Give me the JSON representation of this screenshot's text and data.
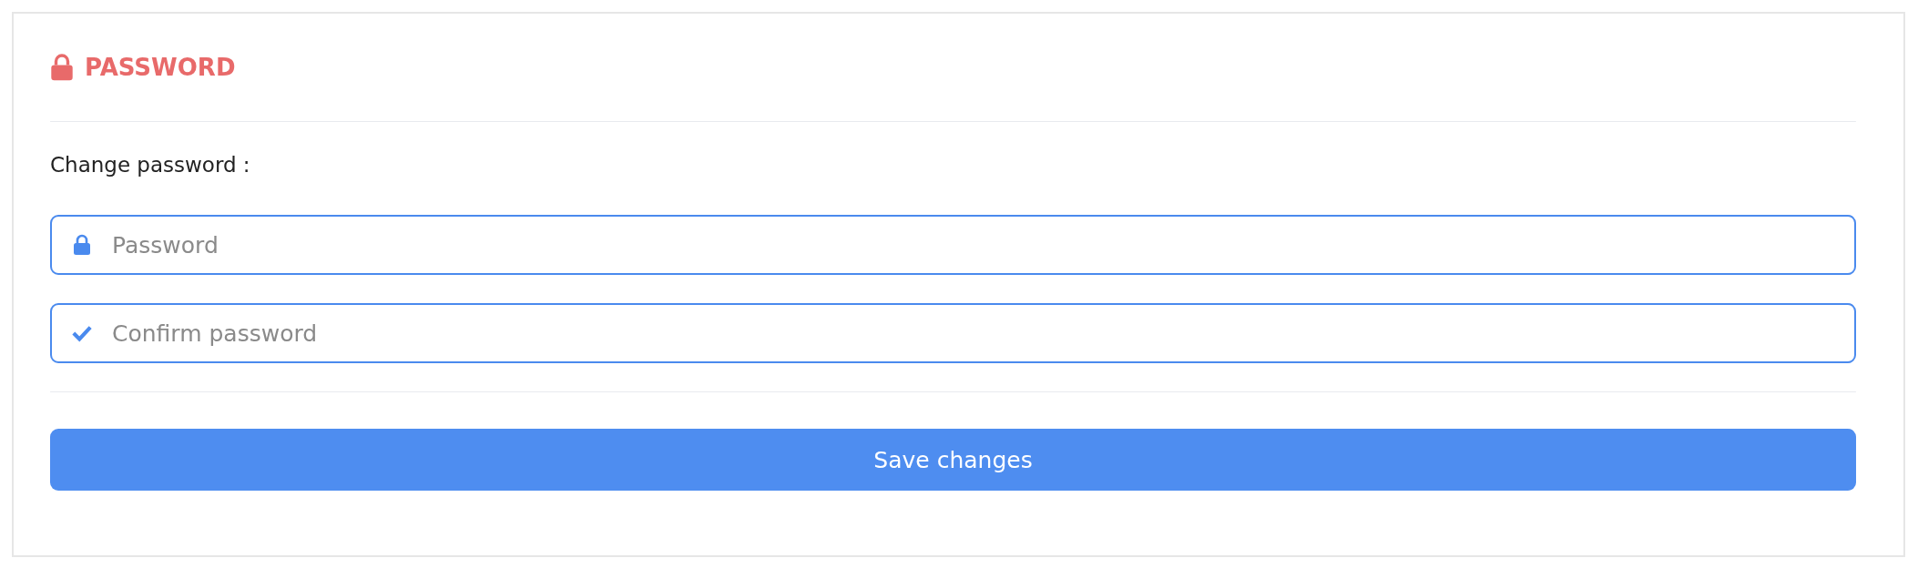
{
  "section": {
    "title": "PASSWORD"
  },
  "label": "Change password :",
  "fields": [
    {
      "kind": "lock",
      "placeholder": "Password"
    },
    {
      "kind": "check",
      "placeholder": "Confirm password"
    }
  ],
  "button": "Save changes"
}
